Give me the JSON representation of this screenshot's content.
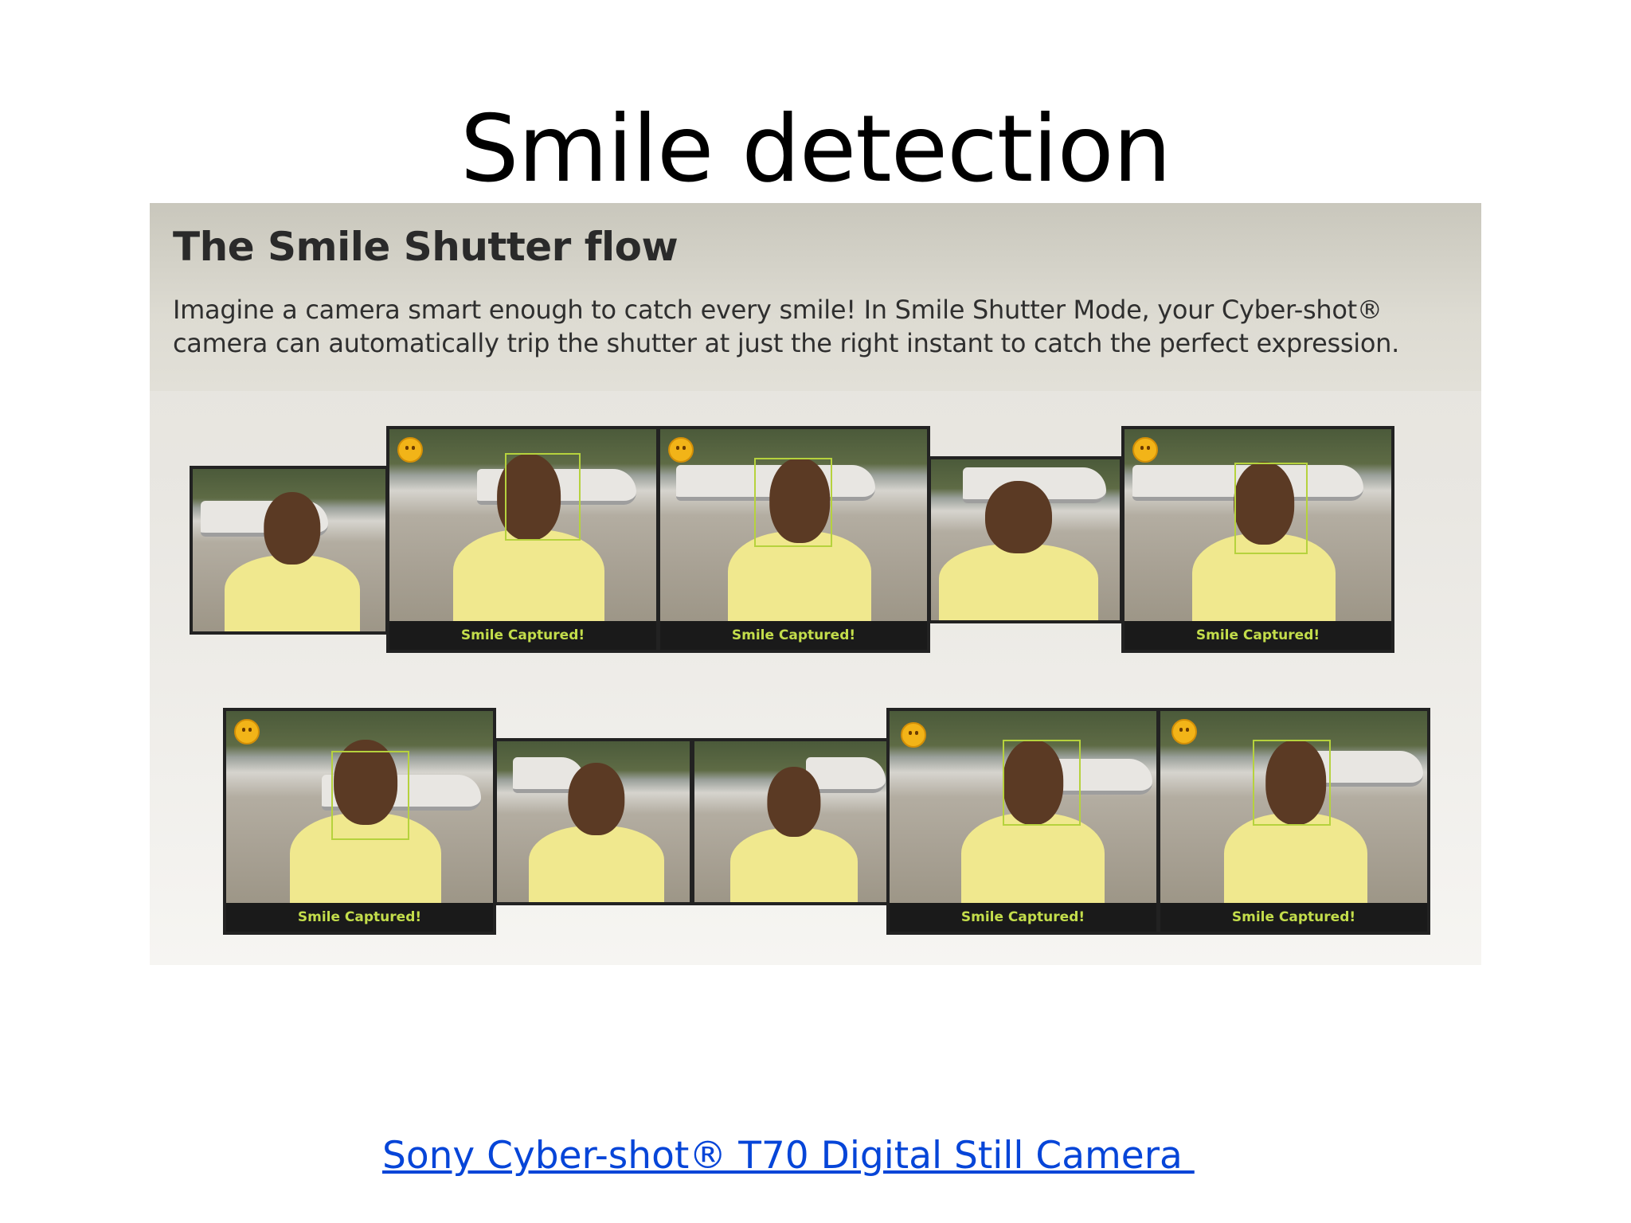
{
  "slide": {
    "title": "Smile detection",
    "link_text": "Sony Cyber-shot® T70 Digital Still Camera "
  },
  "figure": {
    "heading": "The Smile Shutter flow",
    "description": "Imagine a camera smart enough to catch every smile! In Smile Shutter Mode, your Cyber-shot® camera can automatically trip the shutter at just the right instant to catch the perfect expression.",
    "caption": "Smile Captured!",
    "colors": {
      "caption_text": "#c3dd4b",
      "face_box": "#b6d23d",
      "smiley": "#f2b418",
      "link": "#0645d8"
    },
    "row1": [
      {
        "captured": false
      },
      {
        "captured": true
      },
      {
        "captured": true
      },
      {
        "captured": false
      },
      {
        "captured": true
      }
    ],
    "row2": [
      {
        "captured": true
      },
      {
        "captured": false
      },
      {
        "captured": false
      },
      {
        "captured": true
      },
      {
        "captured": true
      }
    ]
  }
}
